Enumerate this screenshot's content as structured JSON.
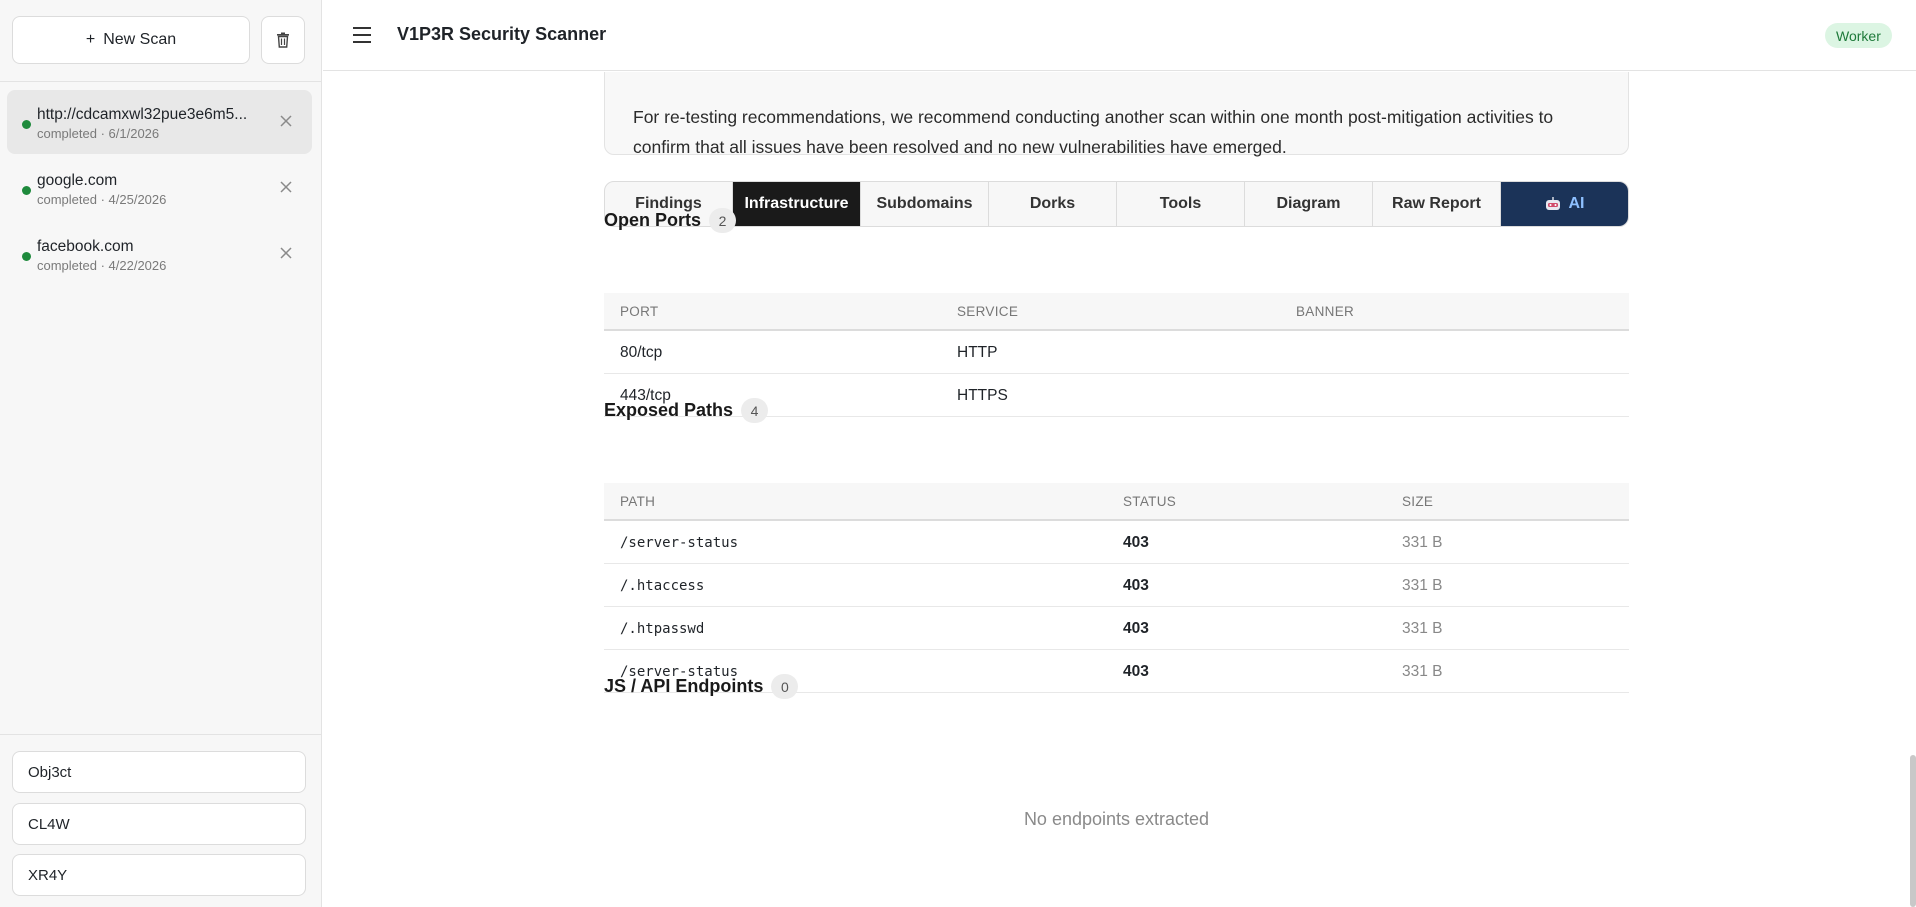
{
  "sidebar": {
    "new_scan_label": "New Scan",
    "scans": [
      {
        "title": "http://cdcamxwl32pue3e6m5...",
        "subtitle": "completed · 6/1/2026",
        "active": true
      },
      {
        "title": "google.com",
        "subtitle": "completed · 4/25/2026",
        "active": false
      },
      {
        "title": "facebook.com",
        "subtitle": "completed · 4/22/2026",
        "active": false
      }
    ],
    "agents": [
      "Obj3ct",
      "CL4W",
      "XR4Y"
    ]
  },
  "header": {
    "title": "V1P3R Security Scanner",
    "badge": "Worker"
  },
  "recommendation": {
    "text": "For re-testing recommendations, we recommend conducting another scan within one month post-mitigation activities to confirm that all issues have been resolved and no new vulnerabilities have emerged."
  },
  "tabs": [
    "Findings",
    "Infrastructure",
    "Subdomains",
    "Dorks",
    "Tools",
    "Diagram",
    "Raw Report",
    "AI"
  ],
  "active_tab": "Infrastructure",
  "open_ports": {
    "title": "Open Ports",
    "count": "2",
    "columns": [
      "PORT",
      "SERVICE",
      "BANNER"
    ],
    "rows": [
      {
        "port": "80/tcp",
        "service": "HTTP",
        "banner": ""
      },
      {
        "port": "443/tcp",
        "service": "HTTPS",
        "banner": ""
      }
    ]
  },
  "exposed_paths": {
    "title": "Exposed Paths",
    "count": "4",
    "columns": [
      "PATH",
      "STATUS",
      "SIZE"
    ],
    "rows": [
      {
        "path": "/server-status",
        "status": "403",
        "size": "331 B"
      },
      {
        "path": "/.htaccess",
        "status": "403",
        "size": "331 B"
      },
      {
        "path": "/.htpasswd",
        "status": "403",
        "size": "331 B"
      },
      {
        "path": "/server-status",
        "status": "403",
        "size": "331 B"
      }
    ]
  },
  "js_endpoints": {
    "title": "JS / API Endpoints",
    "count": "0",
    "empty_text": "No endpoints extracted"
  },
  "colors": {
    "accent_dark": "#1a1a1a",
    "ai_tab": "#1b3358",
    "status_green": "#1e8a3c",
    "badge_bg": "#dcf5e3"
  }
}
